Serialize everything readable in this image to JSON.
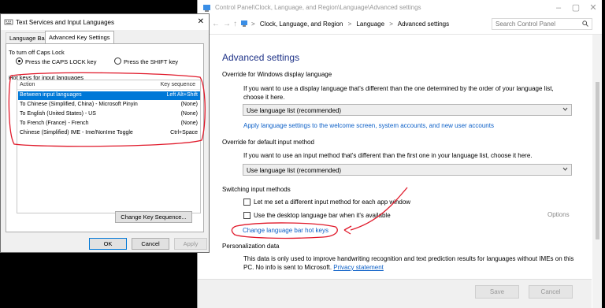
{
  "control_panel": {
    "title": "Control Panel\\Clock, Language, and Region\\Language\\Advanced settings",
    "nav": {
      "back": "←",
      "forward": "→",
      "up": "↑"
    },
    "breadcrumb": [
      "Clock, Language, and Region",
      "Language",
      "Advanced settings"
    ],
    "breadcrumb_sep": ">",
    "search_placeholder": "Search Control Panel",
    "heading": "Advanced settings",
    "override_display": {
      "title": "Override for Windows display language",
      "desc": "If you want to use a display language that's different than the one determined by the order of your language list, choose it here.",
      "select_value": "Use language list (recommended)",
      "link": "Apply language settings to the welcome screen, system accounts, and new user accounts"
    },
    "override_input": {
      "title": "Override for default input method",
      "desc": "If you want to use an input method that's different than the first one in your language list, choose it here.",
      "select_value": "Use language list (recommended)"
    },
    "switching": {
      "title": "Switching input methods",
      "cb1": "Let me set a different input method for each app window",
      "cb2": "Use the desktop language bar when it's available",
      "options": "Options",
      "link": "Change language bar hot keys"
    },
    "personalization": {
      "title": "Personalization data",
      "desc": "This data is only used to improve handwriting recognition and text prediction results for languages without IMEs on this PC. No info is sent to Microsoft.",
      "privacy_link": "Privacy statement"
    },
    "buttons": {
      "save": "Save",
      "cancel": "Cancel"
    }
  },
  "dialog": {
    "title": "Text Services and Input Languages",
    "close": "✕",
    "tabs": [
      "Language Bar",
      "Advanced Key Settings"
    ],
    "caps_group": "To turn off Caps Lock",
    "radio1": "Press the CAPS LOCK key",
    "radio2": "Press the SHIFT key",
    "hotkeys_group": "Hot keys for input languages",
    "col_action": "Action",
    "col_key": "Key sequence",
    "rows": [
      {
        "action": "Between input languages",
        "key": "Left Alt+Shift"
      },
      {
        "action": "To Chinese (Simplified, China) - Microsoft Pinyin",
        "key": "(None)"
      },
      {
        "action": "To English (United States) - US",
        "key": "(None)"
      },
      {
        "action": "To French (France) - French",
        "key": "(None)"
      },
      {
        "action": "Chinese (Simplified) IME - Ime/NonIme Toggle",
        "key": "Ctrl+Space"
      }
    ],
    "change_btn": "Change Key Sequence...",
    "ok": "OK",
    "cancel": "Cancel",
    "apply": "Apply"
  },
  "colors": {
    "heading_blue": "#1e3287",
    "link_blue": "#0b5fc7",
    "selection": "#0078d7",
    "annotation_red": "#e0192a"
  }
}
